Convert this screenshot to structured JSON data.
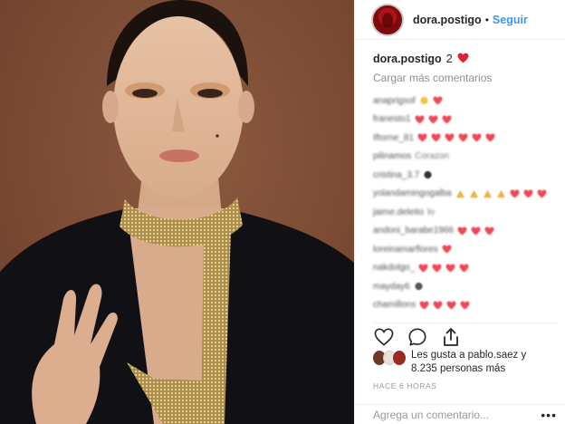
{
  "post": {
    "username": "dora.postigo",
    "follow_label": "Seguir",
    "dot": "•",
    "caption_user": "dora.postigo",
    "caption_text": "2",
    "load_more": "Cargar más comentarios",
    "comments": [
      {
        "user": "anaprigsof",
        "text": "",
        "emoji": [
          "emoji-face-icon",
          "heart-icon"
        ]
      },
      {
        "user": "franesto1",
        "text": "",
        "emoji": [
          "heart-icon",
          "heart-icon",
          "heart-icon"
        ]
      },
      {
        "user": "Iftorne_81",
        "text": "",
        "emoji": [
          "heart-icon",
          "heart-icon",
          "heart-icon",
          "heart-icon",
          "heart-icon",
          "heart-icon"
        ]
      },
      {
        "user": "pilinamos",
        "text": "Corazon",
        "emoji": []
      },
      {
        "user": "cristina_3.7",
        "text": "",
        "emoji": [
          "eyes-icon"
        ]
      },
      {
        "user": "yolandamingogalba",
        "text": "",
        "emoji": [
          "clap-icon",
          "clap-icon",
          "clap-icon",
          "clap-icon",
          "heart-icon",
          "heart-icon",
          "heart-icon"
        ]
      },
      {
        "user": "jaime.deleito",
        "text": "lo",
        "emoji": []
      },
      {
        "user": "andoni_barabe1966",
        "text": "",
        "emoji": [
          "heart-icon",
          "heart-icon",
          "heart-icon"
        ]
      },
      {
        "user": "loreinamarflores",
        "text": "",
        "emoji": [
          "heart-icon"
        ]
      },
      {
        "user": "nakdolgo_",
        "text": "",
        "emoji": [
          "heart-icon",
          "heart-icon",
          "heart-icon",
          "heart-icon"
        ]
      },
      {
        "user": "mayday6",
        "text": "",
        "emoji": [
          "flower-icon"
        ]
      },
      {
        "user": "chamillons",
        "text": "",
        "emoji": [
          "heart-icon",
          "heart-icon",
          "heart-icon",
          "heart-icon"
        ]
      }
    ],
    "likes_text_line1": "Les gusta a pablo.saez y",
    "likes_text_line2": "8.235 personas más",
    "time_ago": "HACE 6 HORAS",
    "add_comment_placeholder": "Agrega un comentario..."
  },
  "colors": {
    "accent": "#3897f0",
    "heart": "#ed4956",
    "caption_heart": "#d9252f"
  },
  "icons": {
    "like": "heart-outline-icon",
    "comment": "comment-bubble-icon",
    "share": "share-icon",
    "more": "more-dots-icon"
  }
}
